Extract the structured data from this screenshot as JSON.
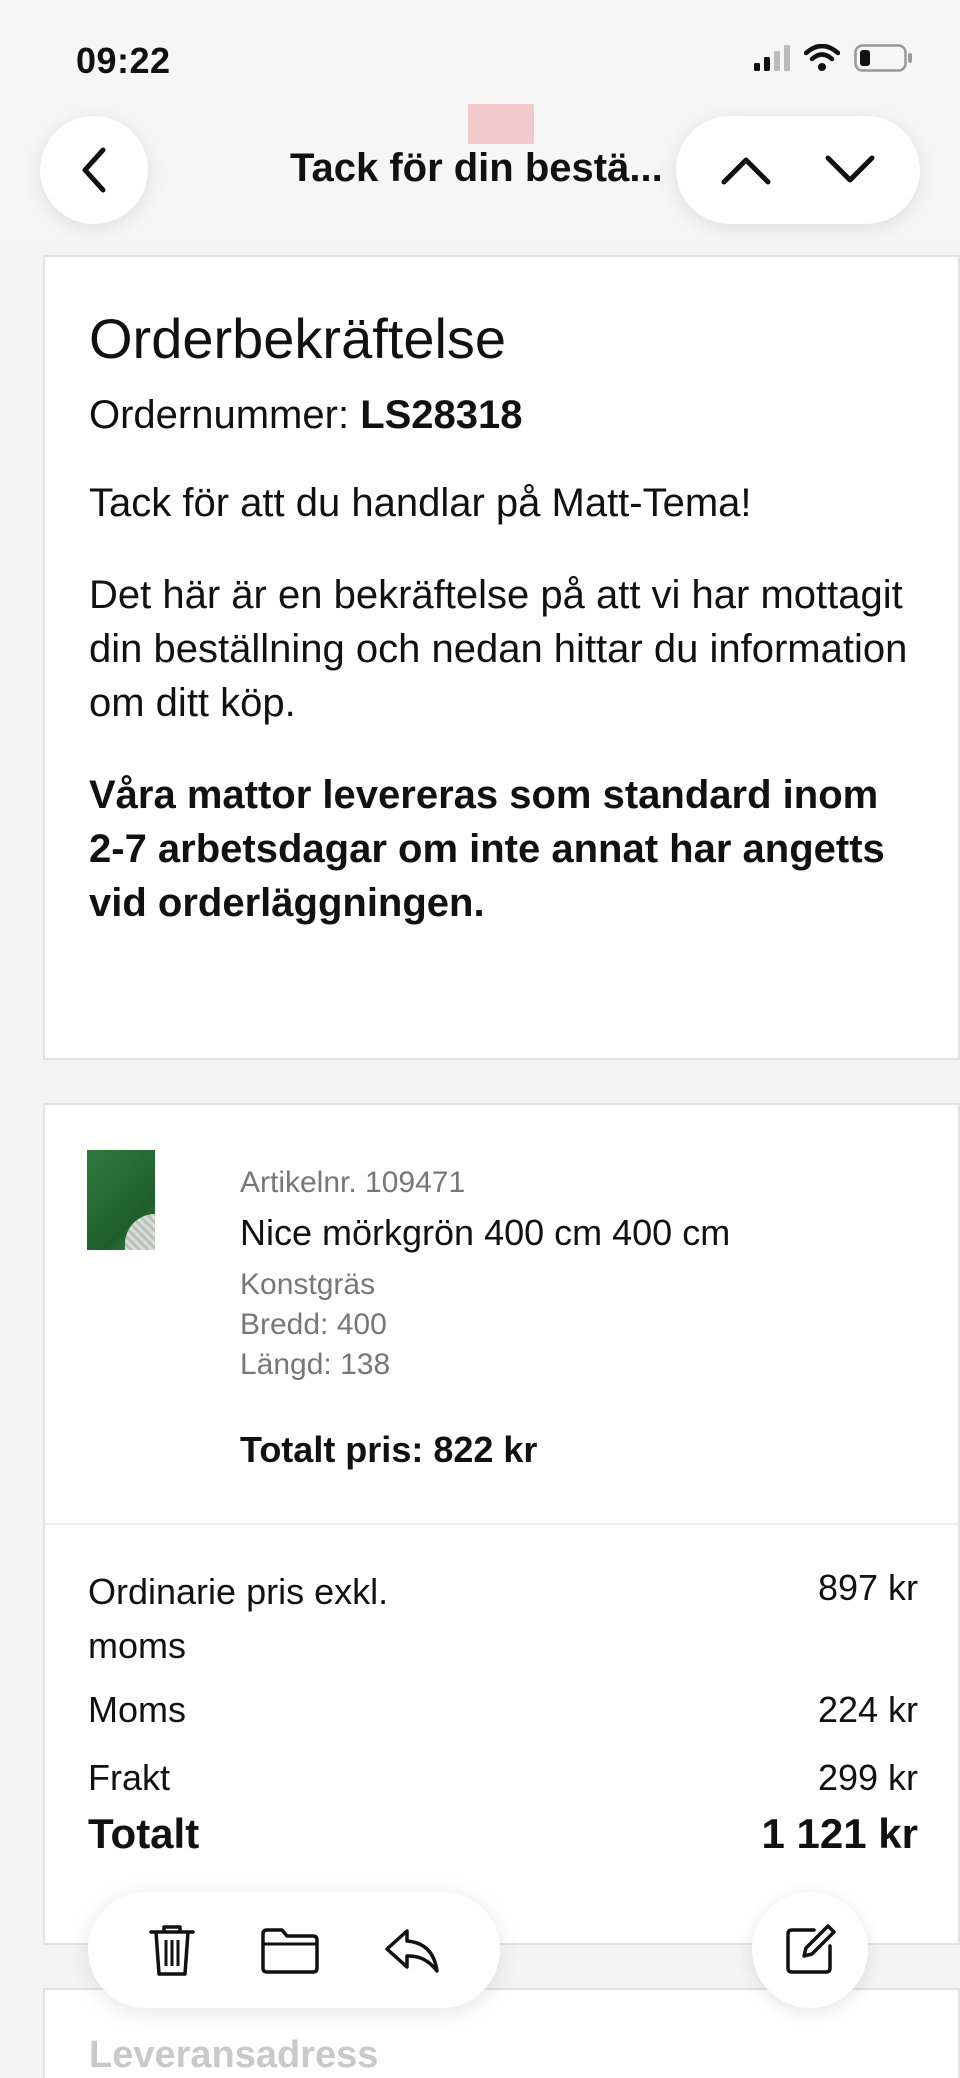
{
  "status_bar": {
    "time": "09:22"
  },
  "nav": {
    "title": "Tack för din bestä..."
  },
  "confirmation": {
    "heading": "Orderbekräftelse",
    "order_label": "Ordernummer:",
    "order_number": "LS28318",
    "thanks": "Tack för att du handlar på Matt-Tema!",
    "info": "Det här är en bekräftelse på att vi har mottagit din beställning och nedan hittar du information om ditt köp.",
    "delivery_note": "Våra mattor levereras som standard inom 2-7 arbetsdagar om inte annat har angetts vid orderläggningen."
  },
  "product": {
    "article": "Artikelnr. 109471",
    "name": "Nice mörkgrön 400 cm 400 cm",
    "type": "Konstgräs",
    "width": "Bredd: 400",
    "length": "Längd: 138",
    "total": "Totalt pris: 822 kr"
  },
  "summary": {
    "ordinary_label": "Ordinarie pris exkl. moms",
    "ordinary_value": "897 kr",
    "vat_label": "Moms",
    "vat_value": "224 kr",
    "shipping_label": "Frakt",
    "shipping_value": "299 kr",
    "total_label": "Totalt",
    "total_value": "1 121 kr"
  },
  "delivery_section": {
    "title": "Leveransadress"
  },
  "colors": {
    "accent_thumb": "#2f7a3c",
    "card_border": "#e3e3e3"
  }
}
